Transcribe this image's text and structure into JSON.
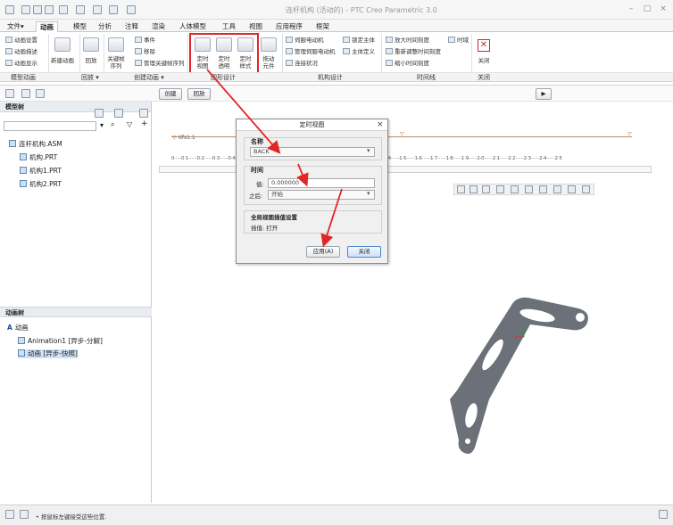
{
  "window": {
    "title": "连杆机构 (活动的) - PTC Creo Parametric 3.0"
  },
  "tabs": [
    {
      "label": "文件▾",
      "active": false
    },
    {
      "label": "动画",
      "active": true
    },
    {
      "label": "模型",
      "active": false
    },
    {
      "label": "分析",
      "active": false
    },
    {
      "label": "注释",
      "active": false
    },
    {
      "label": "渲染",
      "active": false
    },
    {
      "label": "人体模型",
      "active": false
    },
    {
      "label": "工具",
      "active": false
    },
    {
      "label": "视图",
      "active": false
    },
    {
      "label": "应用程序",
      "active": false
    },
    {
      "label": "框架",
      "active": false
    }
  ],
  "ribbon": {
    "model_anim_items": [
      "动画设置",
      "动画描述",
      "动画显示"
    ],
    "new_anim": "新建动画",
    "playback": "回放",
    "keyframe_seq": "关键帧\n序列",
    "create_items": [
      "事件",
      "移除",
      "管理关键帧序列"
    ],
    "timed_view": "定时\n视图",
    "timed_transparency": "定时\n透明",
    "timed_display": "定时\n样式",
    "drag_mech": "拖动\n元件",
    "mech_items": [
      "伺服电动机",
      "管理伺服电动机",
      "连接状况"
    ],
    "lock_items": [
      "锁定主体",
      "主体定义"
    ],
    "timeline_items": [
      "放大时间刻度",
      "重新调整时间刻度",
      "缩小时间刻度"
    ],
    "time_domain": "时域",
    "close": "关闭",
    "groups": [
      "模型动画",
      "回放 ▾",
      "创建动画 ▾",
      "图形设计",
      "机构设计",
      "时间线",
      "关闭"
    ]
  },
  "subbar": {
    "create": "创建",
    "playback": "回放"
  },
  "model_tree": {
    "title": "模型树",
    "items": [
      "连杆机构.ASM",
      "机构.PRT",
      "机构1.PRT",
      "机构2.PRT"
    ]
  },
  "anim_tree": {
    "title": "动画树",
    "items": [
      "动画",
      "Animation1 [异步-分解]",
      "动画 [异步-快照]"
    ]
  },
  "timeline": {
    "kfs_label": "Kfs1.1",
    "ruler": "0·····0·1······0·2······0·3······0·4······0·5······0·6······0·7······0·8······0·9······1·0······1·1······1·2······1·3······1·4······1·5······1·6······1·7······1·8······1·9······2·0······2·1······2·2······2·3······2·4······2·5"
  },
  "dialog": {
    "title": "定时视图",
    "close": "×",
    "name_label": "名称",
    "name_value": "BACK",
    "time_label": "时间",
    "value_label": "值:",
    "value": "0.000000",
    "after_label": "之后:",
    "after_value": "开始",
    "global_label": "全局视图插值设置",
    "interp_label": "插值: 打开",
    "apply": "应用(A)",
    "close_btn": "关闭"
  },
  "status": {
    "text": "• 按鼠标左键接受这些位置."
  },
  "colors": {
    "red_annotation": "#e22626",
    "part_fill": "#6b7079"
  }
}
